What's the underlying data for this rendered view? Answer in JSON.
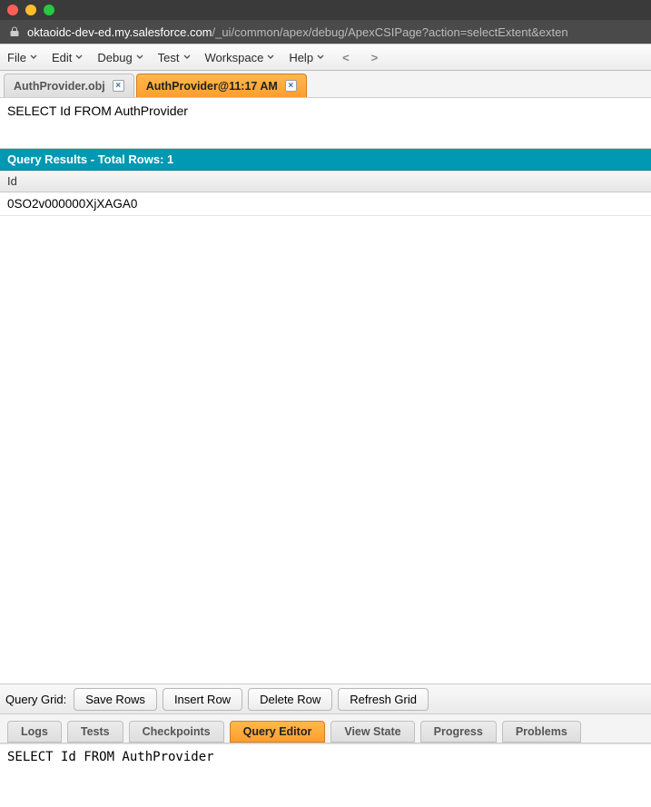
{
  "browser": {
    "url_domain": "oktaoidc-dev-ed.my.salesforce.com",
    "url_path": "/_ui/common/apex/debug/ApexCSIPage?action=selectExtent&exten"
  },
  "menubar": {
    "items": [
      "File",
      "Edit",
      "Debug",
      "Test",
      "Workspace",
      "Help"
    ],
    "nav_back": "<",
    "nav_forward": ">"
  },
  "filetabs": [
    {
      "label": "AuthProvider.obj",
      "active": false
    },
    {
      "label": "AuthProvider@11:17 AM",
      "active": true
    }
  ],
  "query_panel": {
    "query_text": "SELECT Id FROM AuthProvider",
    "results_header": "Query Results - Total Rows: 1",
    "columns": [
      "Id"
    ],
    "rows": [
      {
        "Id": "0SO2v000000XjXAGA0"
      }
    ]
  },
  "query_grid_toolbar": {
    "label": "Query Grid:",
    "buttons": [
      "Save Rows",
      "Insert Row",
      "Delete Row",
      "Refresh Grid"
    ]
  },
  "bottom_tabs": {
    "items": [
      "Logs",
      "Tests",
      "Checkpoints",
      "Query Editor",
      "View State",
      "Progress",
      "Problems"
    ],
    "active": "Query Editor"
  },
  "editor": {
    "content": "SELECT Id FROM AuthProvider"
  }
}
